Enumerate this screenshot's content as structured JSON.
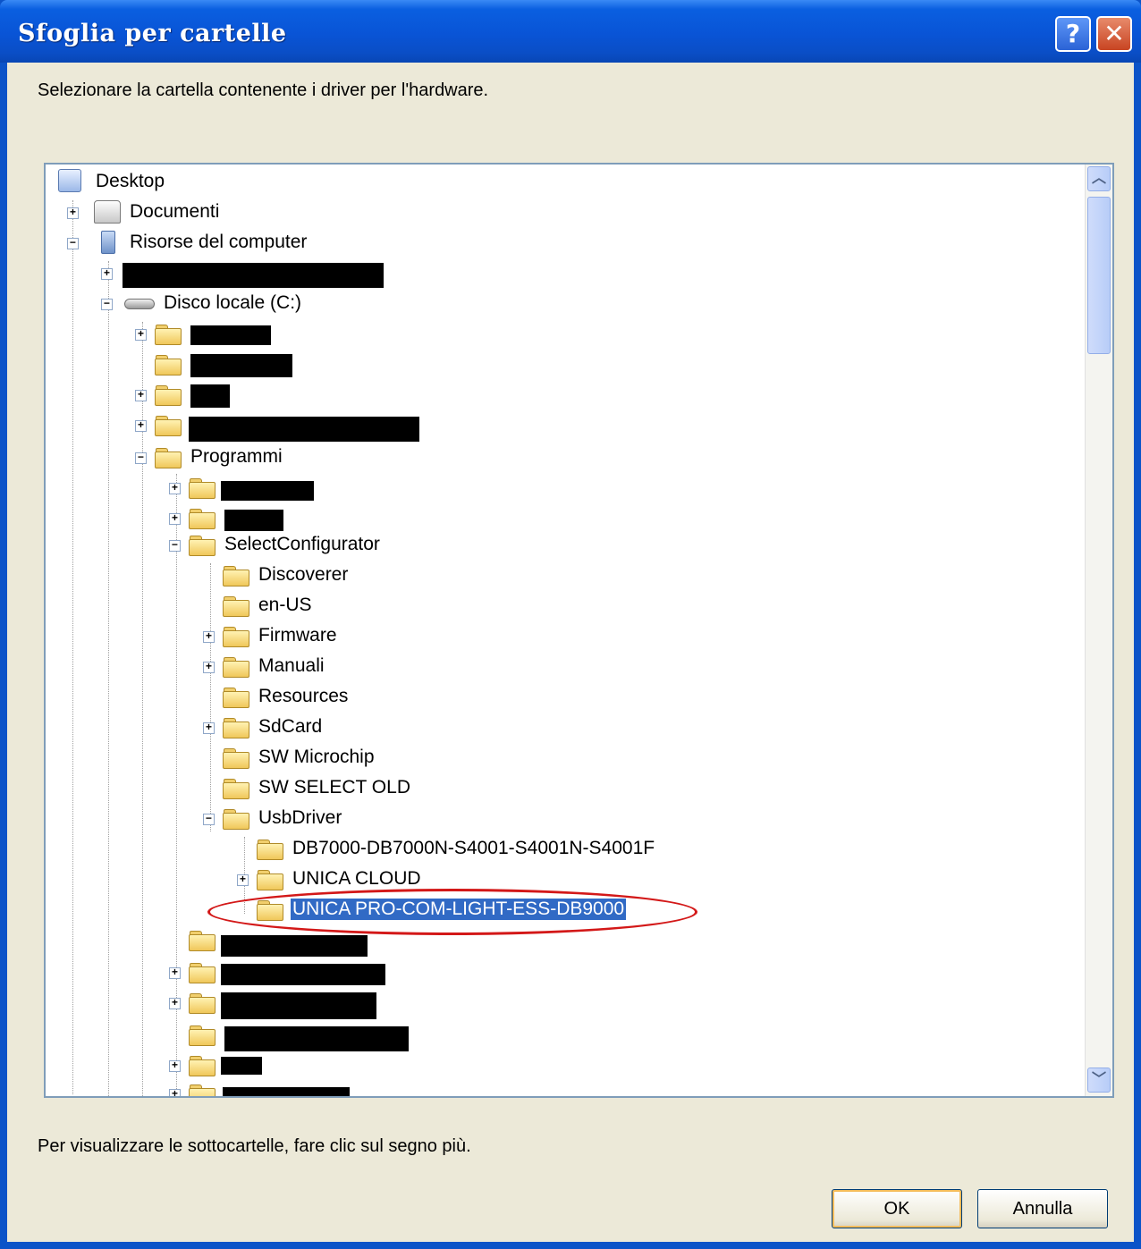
{
  "window": {
    "title": "Sfoglia per cartelle",
    "help_glyph": "?",
    "close_glyph": "✕"
  },
  "instruction": "Selezionare la cartella contenente i driver per l'hardware.",
  "tree": {
    "desktop": "Desktop",
    "documenti": "Documenti",
    "risorse": "Risorse del computer",
    "disco": "Disco locale (C:)",
    "programmi": "Programmi",
    "selectconfigurator": "SelectConfigurator",
    "discoverer": "Discoverer",
    "en_us": "en-US",
    "firmware": "Firmware",
    "manuali": "Manuali",
    "resources": "Resources",
    "sdcard": "SdCard",
    "sw_microchip": "SW Microchip",
    "sw_select_old": "SW SELECT OLD",
    "usbdriver": "UsbDriver",
    "db7000": "DB7000-DB7000N-S4001-S4001N-S4001F",
    "unica_cloud": "UNICA CLOUD",
    "unica_pro": "UNICA PRO-COM-LIGHT-ESS-DB9000",
    "plus": "+",
    "minus": "−"
  },
  "scrollbar": {
    "up_glyph": "︿",
    "down_glyph": "﹀"
  },
  "hint": "Per visualizzare le sottocartelle, fare clic sul segno più.",
  "buttons": {
    "ok": "OK",
    "cancel": "Annulla"
  },
  "colors": {
    "title_bar": "#0954d6",
    "selection": "#316ac5",
    "annotation": "#d31818"
  }
}
